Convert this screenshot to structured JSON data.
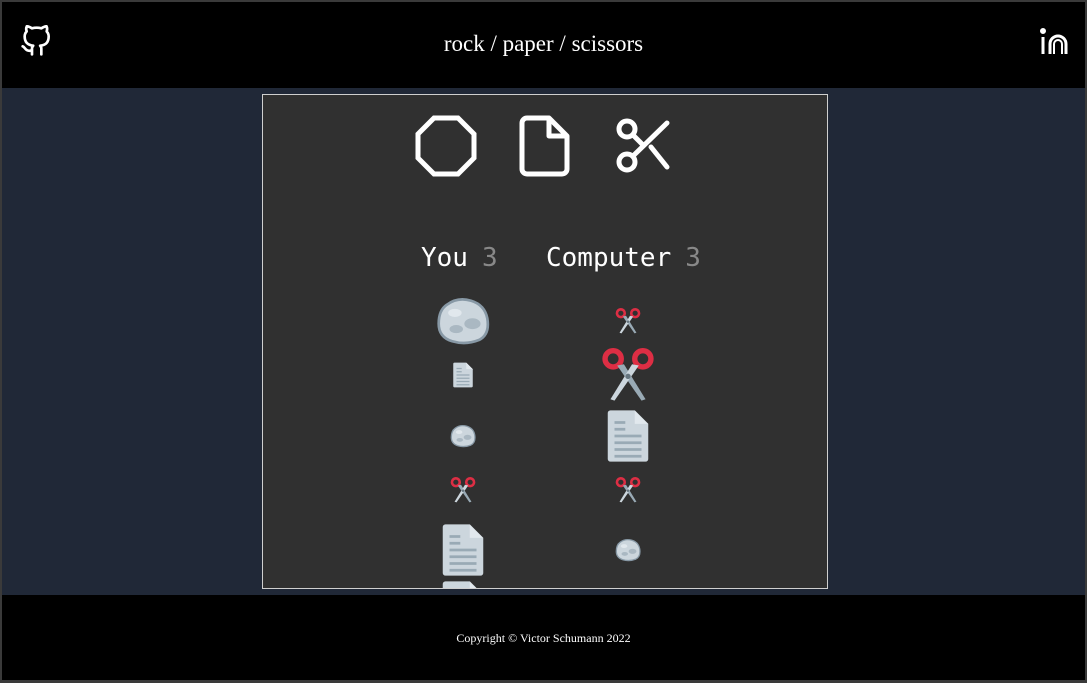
{
  "header": {
    "title": "rock / paper / scissors",
    "github_icon": "github-icon",
    "linkedin_icon": "linkedin-icon"
  },
  "choices": [
    {
      "move": "rock",
      "icon": "octagon-icon"
    },
    {
      "move": "paper",
      "icon": "file-icon"
    },
    {
      "move": "scissors",
      "icon": "scissors-icon"
    }
  ],
  "scoreboard": {
    "player_label": "You",
    "player_score": "3",
    "computer_label": "Computer",
    "computer_score": "3"
  },
  "history": [
    {
      "you": "rock",
      "computer": "scissors",
      "winner": "you"
    },
    {
      "you": "paper",
      "computer": "scissors",
      "winner": "computer"
    },
    {
      "you": "rock",
      "computer": "paper",
      "winner": "computer"
    },
    {
      "you": "scissors",
      "computer": "scissors",
      "winner": "tie"
    },
    {
      "you": "paper",
      "computer": "rock",
      "winner": "you"
    },
    {
      "you": "paper",
      "computer": null,
      "winner": "you"
    }
  ],
  "colors": {
    "header_bg": "#000000",
    "body_bg": "#202837",
    "panel_bg": "#303030",
    "score_number": "#888888",
    "scissors_red": "#dd2e44"
  },
  "footer": {
    "copyright": "Copyright © Victor Schumann 2022"
  }
}
